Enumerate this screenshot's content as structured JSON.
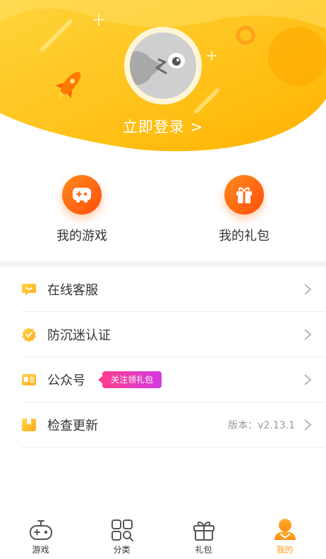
{
  "header": {
    "login_label": "立即登录 >"
  },
  "quick_entries": [
    {
      "label": "我的游戏",
      "icon": "gamepad-icon"
    },
    {
      "label": "我的礼包",
      "icon": "gift-icon"
    }
  ],
  "menu": {
    "items": [
      {
        "label": "在线客服",
        "icon": "chat-icon"
      },
      {
        "label": "防沉迷认证",
        "icon": "verified-badge-icon"
      },
      {
        "label": "公众号",
        "icon": "id-card-icon",
        "badge": "关注领礼包"
      },
      {
        "label": "检查更新",
        "icon": "bookmark-icon",
        "version": "版本：v2.13.1"
      }
    ]
  },
  "tabbar": {
    "items": [
      {
        "label": "游戏",
        "icon": "gamepad-icon"
      },
      {
        "label": "分类",
        "icon": "category-grid-icon"
      },
      {
        "label": "礼包",
        "icon": "gift-icon"
      },
      {
        "label": "我的",
        "icon": "profile-icon",
        "active": true
      }
    ]
  },
  "colors": {
    "brand_orange": "#ff9a1a",
    "header_yellow": "#ffc107",
    "badge_pink": "#ff3d8f"
  }
}
